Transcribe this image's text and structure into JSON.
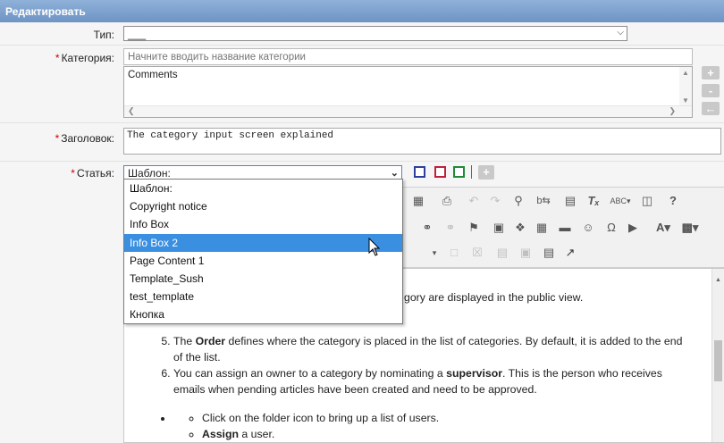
{
  "header": {
    "title": "Редактировать"
  },
  "form": {
    "type_label": "Тип:",
    "type_value": "___",
    "category_label": "Категория:",
    "category_placeholder": "Начните вводить название категории",
    "category_list_value": "Comments",
    "title_label": "Заголовок:",
    "title_value": "The category input screen explained",
    "article_label": "Статья:",
    "template_value": "Шаблон:",
    "required_mark": "*"
  },
  "side_buttons": [
    "+",
    "-",
    "←"
  ],
  "template_dropdown": {
    "options": [
      "Шаблон:",
      "Copyright notice",
      "Info Box",
      "Info Box 2",
      "Page Content 1",
      "Template_Sush",
      "test_template",
      "Кнопка"
    ],
    "highlighted": "Info Box 2"
  },
  "editor": {
    "partial_line": "gory are displayed in the public view.",
    "item5_pre": "The ",
    "item5_bold": "Order",
    "item5_post": " defines where the category is placed in the list of categories. By default, it is added to the end of the list.",
    "item6_pre": "You can assign an owner to a category by nominating a ",
    "item6_bold": "supervisor",
    "item6_post": ". This is the person who receives emails when pending articles have been created and need to be approved.",
    "sub1": "Click on the folder icon to bring up a list of users.",
    "sub2_bold": "Assign",
    "sub2_post": " a user."
  },
  "toolbar_icons": [
    "select-all-icon",
    "print-icon",
    "undo-icon",
    "redo-icon",
    "find-icon",
    "replace-icon",
    "paste-icon",
    "remove-format-icon",
    "spellcheck-icon",
    "maximize-icon",
    "help-icon",
    "link-icon",
    "unlink-icon",
    "anchor-icon",
    "image-icon",
    "flash-icon",
    "table-icon",
    "hr-icon",
    "smiley-icon",
    "special-char-icon",
    "pagebreak-icon",
    "text-color-icon",
    "bg-color-icon",
    "source-icon",
    "fullscreen-icon",
    "video-icon",
    "preview-icon"
  ]
}
